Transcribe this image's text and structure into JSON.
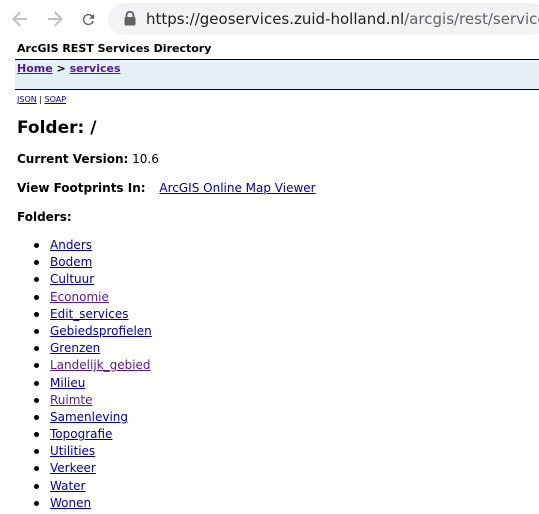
{
  "browser": {
    "url_host": "https://geoservices.zuid-holland.nl",
    "url_path": "/arcgis/rest/services",
    "icons": {
      "back": "back-arrow-icon",
      "forward": "forward-arrow-icon",
      "reload": "reload-icon",
      "security": "lock-icon"
    }
  },
  "page": {
    "directory_title": "ArcGIS REST Services Directory",
    "breadcrumb": {
      "home": "Home",
      "separator": ">",
      "current": "services"
    },
    "formats": {
      "json": "JSON",
      "separator": "|",
      "soap": "SOAP"
    },
    "folder_heading": "Folder: /",
    "current_version_label": "Current Version:",
    "current_version_value": "10.6",
    "view_footprints_label": "View Footprints In:",
    "view_footprints_link": "ArcGIS Online Map Viewer",
    "folders_label": "Folders:",
    "folders": [
      "Anders",
      "Bodem",
      "Cultuur",
      "Economie",
      "Edit_services",
      "Gebiedsprofielen",
      "Grenzen",
      "Landelijk_gebied",
      "Milieu",
      "Ruimte",
      "Samenleving",
      "Topografie",
      "Utilities",
      "Verkeer",
      "Water",
      "Wonen"
    ],
    "colors": {
      "link": "#000099",
      "visited_link": "#551a8b",
      "navbar_background": "#e5eff7"
    }
  }
}
